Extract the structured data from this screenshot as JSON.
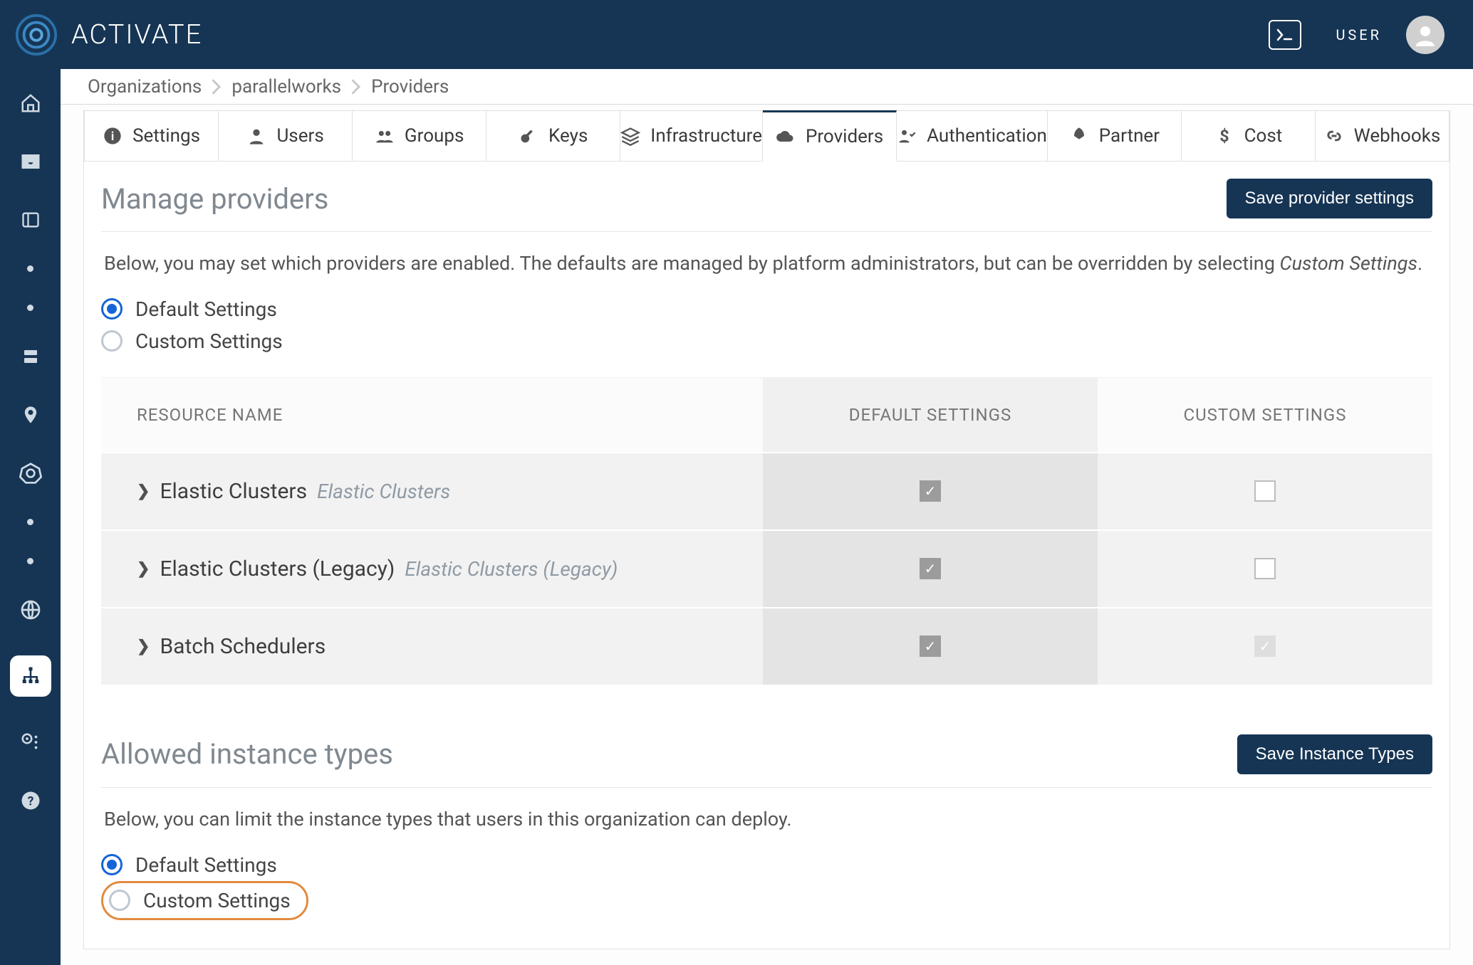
{
  "brand": "ACTIVATE",
  "user_label": "USER",
  "breadcrumbs": [
    "Organizations",
    "parallelworks",
    "Providers"
  ],
  "tabs": [
    {
      "label": "Settings"
    },
    {
      "label": "Users"
    },
    {
      "label": "Groups"
    },
    {
      "label": "Keys"
    },
    {
      "label": "Infrastructure"
    },
    {
      "label": "Providers",
      "active": true
    },
    {
      "label": "Authentication"
    },
    {
      "label": "Partner"
    },
    {
      "label": "Cost"
    },
    {
      "label": "Webhooks"
    }
  ],
  "providers": {
    "title": "Manage providers",
    "save_label": "Save provider settings",
    "desc_a": "Below, you may set which providers are enabled. The defaults are managed by platform administrators, but can be overridden by selecting ",
    "desc_em": "Custom Settings",
    "desc_b": ".",
    "radio_default": "Default Settings",
    "radio_custom": "Custom Settings",
    "th_resource": "RESOURCE NAME",
    "th_default": "DEFAULT SETTINGS",
    "th_custom": "CUSTOM SETTINGS",
    "rows": [
      {
        "name": "Elastic Clusters",
        "hint": "Elastic Clusters",
        "def": true,
        "custom": "empty"
      },
      {
        "name": "Elastic Clusters (Legacy)",
        "hint": "Elastic Clusters (Legacy)",
        "def": true,
        "custom": "empty"
      },
      {
        "name": "Batch Schedulers",
        "hint": "",
        "def": true,
        "custom": "disabled"
      }
    ]
  },
  "instances": {
    "title": "Allowed instance types",
    "save_label": "Save Instance Types",
    "desc": "Below, you can limit the instance types that users in this organization can deploy.",
    "radio_default": "Default Settings",
    "radio_custom": "Custom Settings"
  }
}
